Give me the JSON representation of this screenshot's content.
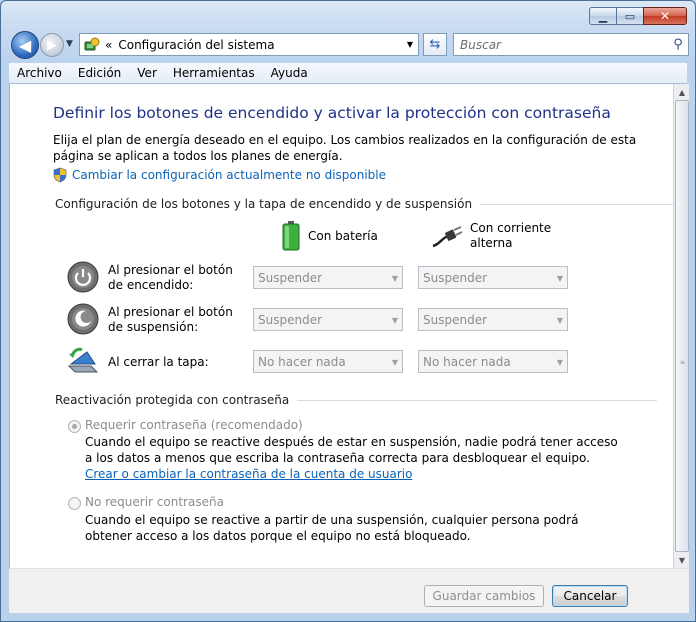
{
  "window": {
    "address": "Configuración del sistema",
    "search_placeholder": "Buscar"
  },
  "menu": [
    "Archivo",
    "Edición",
    "Ver",
    "Herramientas",
    "Ayuda"
  ],
  "page": {
    "title": "Definir los botones de encendido y activar la protección con contraseña",
    "description": "Elija el plan de energía deseado en el equipo. Los cambios realizados en la configuración de esta página se aplican a todos los planes de energía.",
    "change_settings_link": "Cambiar la configuración actualmente no disponible"
  },
  "buttons_section": {
    "heading": "Configuración de los botones y la tapa de encendido y de suspensión",
    "col_battery": "Con batería",
    "col_ac_line1": "Con corriente",
    "col_ac_line2": "alterna",
    "rows": [
      {
        "label": "Al presionar el botón de encendido:",
        "battery": "Suspender",
        "ac": "Suspender",
        "icon": "power-button-icon"
      },
      {
        "label": "Al presionar el botón de suspensión:",
        "battery": "Suspender",
        "ac": "Suspender",
        "icon": "sleep-button-icon"
      },
      {
        "label": "Al cerrar la tapa:",
        "battery": "No hacer nada",
        "ac": "No hacer nada",
        "icon": "laptop-lid-icon"
      }
    ]
  },
  "password_section": {
    "heading": "Reactivación protegida con contraseña",
    "require_label": "Requerir contraseña (recomendado)",
    "require_desc": "Cuando el equipo se reactive después de estar en suspensión, nadie podrá tener acceso a los datos a menos que escriba la contraseña correcta para desbloquear el equipo.",
    "require_link": "Crear o cambiar la contraseña de la cuenta de usuario",
    "norequire_label": "No requerir contraseña",
    "norequire_desc": "Cuando el equipo se reactive a partir de una suspensión, cualquier persona podrá obtener acceso a los datos porque el equipo no está bloqueado."
  },
  "footer": {
    "save": "Guardar cambios",
    "cancel": "Cancelar"
  }
}
